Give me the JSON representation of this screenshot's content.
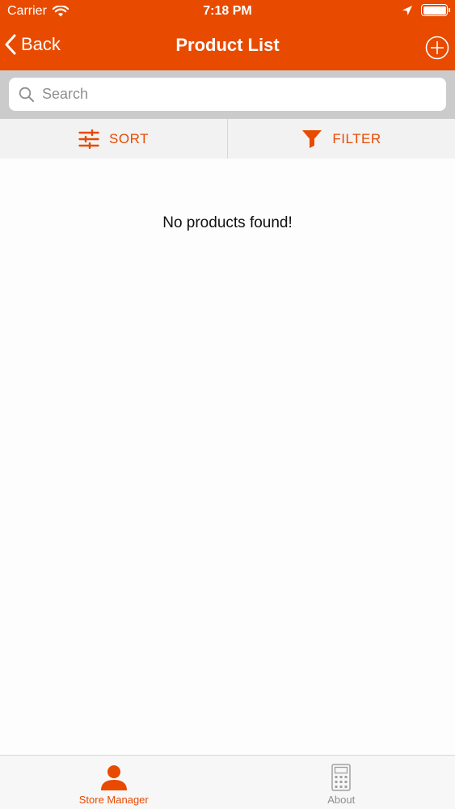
{
  "status_bar": {
    "carrier": "Carrier",
    "time": "7:18 PM"
  },
  "nav": {
    "back_label": "Back",
    "title": "Product List",
    "add_icon": "plus-circle-icon"
  },
  "search": {
    "placeholder": "Search",
    "value": ""
  },
  "toolbar": {
    "sort_label": "SORT",
    "filter_label": "FILTER"
  },
  "content": {
    "empty_message": "No products found!"
  },
  "tab_bar": {
    "items": [
      {
        "label": "Store Manager",
        "icon": "person-icon",
        "active": true
      },
      {
        "label": "About",
        "icon": "calculator-icon",
        "active": false
      }
    ]
  },
  "colors": {
    "accent": "#e84a00",
    "search_bg": "#cbcbcb",
    "toolbar_bg": "#f2f2f2",
    "tab_inactive": "#8e8e93"
  }
}
